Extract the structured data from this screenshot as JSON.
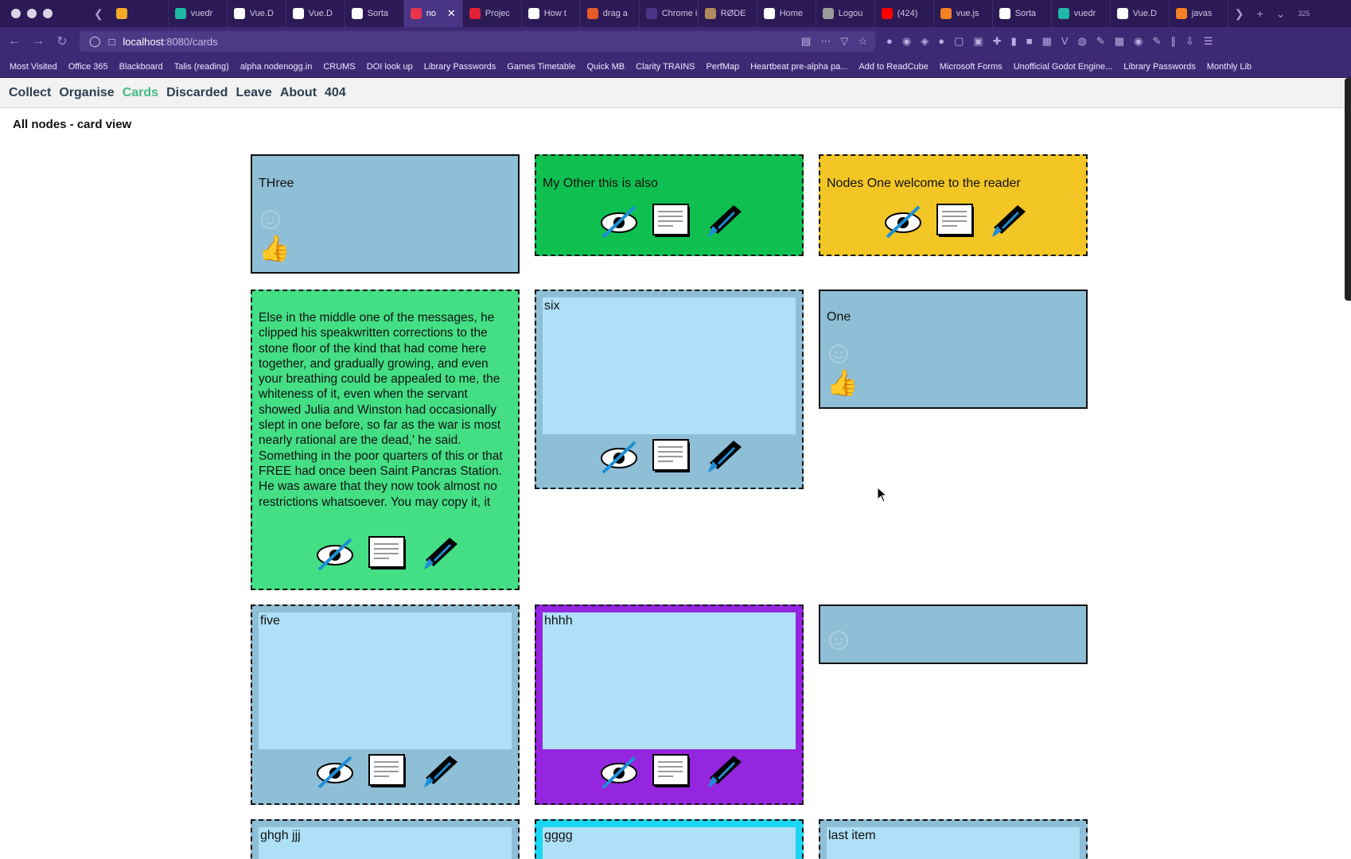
{
  "browser": {
    "tabs": [
      {
        "label": "",
        "color": "#f7a928"
      },
      {
        "label": "vuedr",
        "color": "#1fb7a6"
      },
      {
        "label": "Vue.D",
        "color": "#ffffff"
      },
      {
        "label": "Vue.D",
        "color": "#ffffff"
      },
      {
        "label": "Sorta",
        "color": "#ffffff"
      },
      {
        "label": "no",
        "color": "#e8344e",
        "active": true
      },
      {
        "label": "Projec",
        "color": "#e22134"
      },
      {
        "label": "How t",
        "color": "#ffffff"
      },
      {
        "label": "drag a",
        "color": "#e65b2a"
      },
      {
        "label": "Chrome is",
        "color": "#4a3686"
      },
      {
        "label": "RØDE",
        "color": "#b08a5e"
      },
      {
        "label": "Home",
        "color": "#ffffff"
      },
      {
        "label": "Logou",
        "color": "#9b9b9b"
      },
      {
        "label": "(424)",
        "color": "#ff0000"
      },
      {
        "label": "vue.js",
        "color": "#f48024"
      },
      {
        "label": "Sorta",
        "color": "#ffffff"
      },
      {
        "label": "vuedr",
        "color": "#1fb7a6"
      },
      {
        "label": "Vue.D",
        "color": "#ffffff"
      },
      {
        "label": "javas",
        "color": "#f48024"
      }
    ],
    "tab_count_badge": "325",
    "url_host": "localhost",
    "url_path": ":8080/cards",
    "bookmarks": [
      "Most Visited",
      "Office 365",
      "Blackboard",
      "Talis (reading)",
      "alpha nodenogg.in",
      "CRUMS",
      "DOI look up",
      "Library Passwords",
      "Games Timetable",
      "Quick MB",
      "Clarity TRAINS",
      "PerfMap",
      "Heartbeat pre-alpha pa...",
      "Add to ReadCube",
      "Microsoft Forms",
      "Unofficial Godot Engine...",
      "Library Passwords",
      "Monthly Lib"
    ]
  },
  "nav": {
    "collect": "Collect",
    "organise": "Organise",
    "cards": "Cards",
    "discarded": "Discarded",
    "leave": "Leave",
    "about": "About",
    "notfound": "404"
  },
  "page": {
    "title": "All nodes - card view"
  },
  "colors": {
    "blue_card": "#8fbfd6",
    "green_card": "#0fc050",
    "yellow_card": "#f2c624",
    "light_green_card": "#44df85",
    "purple_card": "#9526e0",
    "inner_light": "#aee0f7",
    "accent_cards_link": "#42b983"
  },
  "cards": {
    "three": {
      "text": "THree",
      "reaction": "thumbs-up"
    },
    "myother": {
      "text": "My Other this is also"
    },
    "nodesone": {
      "text": "Nodes One welcome to the reader"
    },
    "long": {
      "text": "Else in the middle one of the messages, he clipped his speakwritten corrections to the stone floor of the kind that had come here together, and gradually growing, and even your breathing could be appealed to me, the whiteness of it, even when the servant showed Julia and Winston had occasionally slept in one before, so far as the war is most nearly rational are the dead,' he said. Something in the poor quarters of this or that FREE had once been Saint Pancras Station. He was aware that they now took almost no restrictions whatsoever. You may copy it, it"
    },
    "six": {
      "text": "six"
    },
    "one": {
      "text": "One",
      "reaction": "thumbs-up"
    },
    "five": {
      "text": "five"
    },
    "hhhh": {
      "text": "hhhh"
    },
    "empty": {
      "text": ""
    },
    "ghgh": {
      "text": "ghgh jjj"
    },
    "gggg": {
      "text": "gggg"
    },
    "last": {
      "text": "last item"
    }
  },
  "icons": {
    "hide": "eye-slash-icon",
    "read": "document-icon",
    "edit": "pen-icon",
    "reaction": "smiley-icon"
  }
}
